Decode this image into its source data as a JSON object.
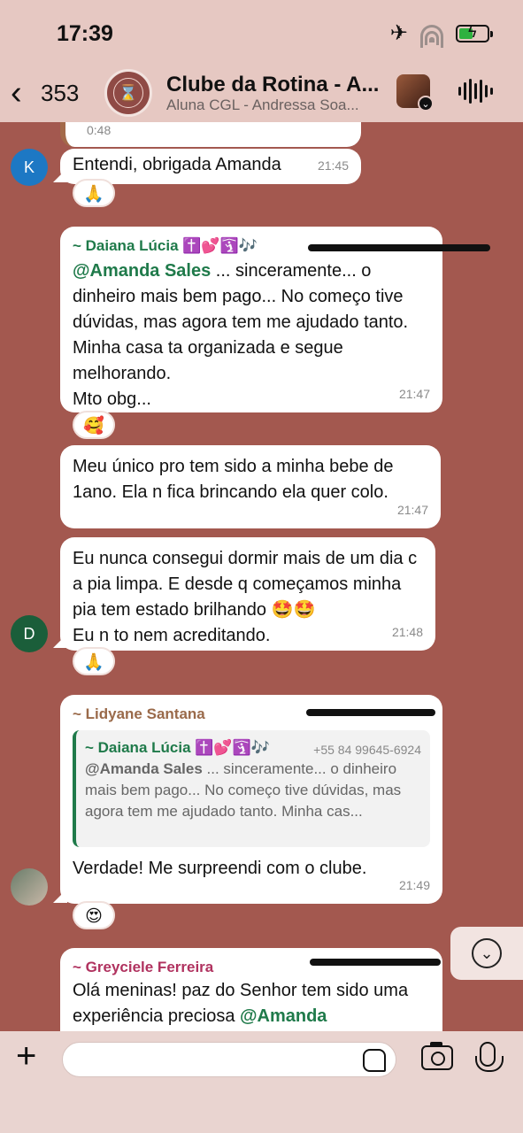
{
  "status": {
    "time": "17:39"
  },
  "header": {
    "back_count": "353",
    "title": "Clube da Rotina - A...",
    "subtitle": "Aluna CGL - Andressa Soa..."
  },
  "messages": {
    "partial_top": {
      "text": "0:48"
    },
    "m1": {
      "avatar": "K",
      "text": "Entendi, obrigada Amanda",
      "time": "21:45",
      "reaction": "🙏"
    },
    "m2": {
      "sender": "~ Daiana Lúcia ✝️💕🛐🎶",
      "mention": "@Amanda Sales",
      "text_after": " ... sinceramente... o dinheiro mais bem pago... No começo tive dúvidas,  mas agora tem me ajudado tanto. Minha casa ta organizada e segue melhorando.",
      "text_line2": "Mto obg...",
      "time": "21:47",
      "reaction": "🥰"
    },
    "m3": {
      "text": "Meu único pro tem sido a minha bebe de 1ano. Ela n fica brincando ela quer colo.",
      "time": "21:47"
    },
    "m4": {
      "avatar": "D",
      "text": "Eu nunca consegui dormir mais de um dia c a pia limpa. E desde q começamos minha pia tem estado brilhando 🤩🤩",
      "text_line2": "Eu n to nem acreditando.",
      "time": "21:48",
      "reaction": "🙏"
    },
    "m5": {
      "sender": "~ Lidyane Santana",
      "quote_sender": "~ Daiana Lúcia ✝️💕🛐🎶",
      "quote_phone": "+55 84 99645-6924",
      "quote_mention": "@Amanda Sales",
      "quote_text": " ... sinceramente... o dinheiro mais bem pago... No começo tive dúvidas, mas agora tem me ajudado tanto. Minha cas...",
      "text": "Verdade! Me surpreendi com o clube.",
      "time": "21:49",
      "reaction": "😍"
    },
    "m6": {
      "sender": "~ Greyciele Ferreira",
      "text": "Olá meninas! paz do Senhor tem sido uma experiência preciosa ",
      "mention": "@Amanda"
    }
  },
  "colors": {
    "chat_bg": "#a3584f",
    "header_bg": "#e6c8c2",
    "mention": "#1f7a4a",
    "sender_daiana": "#1f7a4a",
    "sender_lidyane": "#9a6a4a",
    "sender_greyciele": "#b0325f",
    "avatar_k": "#1d78c4",
    "avatar_d": "#1b5e3a"
  },
  "icons": [
    "chevron-left-icon",
    "airplane-icon",
    "wifi-icon",
    "battery-icon",
    "waveform-icon",
    "plus-icon",
    "sticker-icon",
    "camera-icon",
    "microphone-icon",
    "chevron-down-icon"
  ]
}
